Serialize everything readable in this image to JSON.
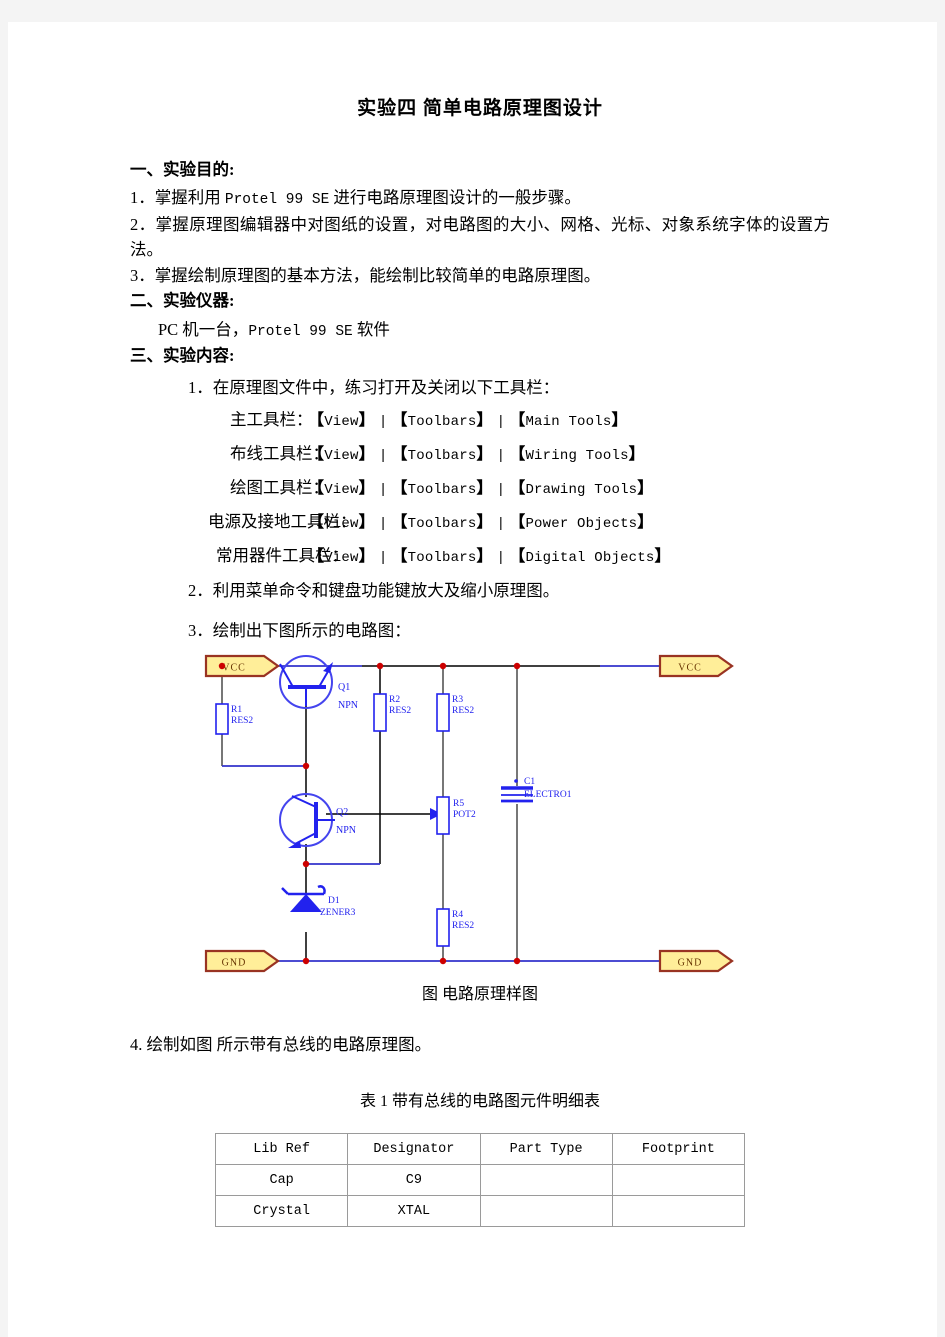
{
  "document": {
    "title": "实验四  简单电路原理图设计",
    "sections": [
      {
        "heading": "一、实验目的:"
      },
      {
        "heading": "二、实验仪器:"
      },
      {
        "heading": "三、实验内容:"
      }
    ],
    "purpose_items": [
      "1．掌握利用 Protel 99   SE 进行电路原理图设计的一般步骤。",
      "2．掌握原理图编辑器中对图纸的设置，对电路图的大小、网格、光标、对象系统字体的设置方法。",
      "3．掌握绘制原理图的基本方法，能绘制比较简单的电路原理图。"
    ],
    "purpose_1_pre": "1．掌握利用 ",
    "purpose_1_mono": "Protel 99   SE",
    "purpose_1_post": " 进行电路原理图设计的一般步骤。",
    "purpose_2": "2．掌握原理图编辑器中对图纸的设置，对电路图的大小、网格、光标、对象系统字体的设置方法。",
    "purpose_3": "3．掌握绘制原理图的基本方法，能绘制比较简单的电路原理图。",
    "instrument_pre": "PC 机一台，",
    "instrument_mono": "Protel 99 SE",
    "instrument_post": " 软件",
    "content_item_1": "1．在原理图文件中，练习打开及关闭以下工具栏：",
    "content_item_2": "2．利用菜单命令和键盘功能键放大及缩小原理图。",
    "content_item_3": "3．绘制出下图所示的电路图：",
    "content_item_4": "4.  绘制如图  所示带有总线的电路原理图。",
    "figure_caption": "图  电路原理样图",
    "table_caption": "表 1  带有总线的电路图元件明细表"
  },
  "toolbars": [
    {
      "label": "主工具栏：",
      "menu": "View",
      "sub": "Toolbars",
      "item": "Main Tools"
    },
    {
      "label": "布线工具栏：",
      "menu": "View",
      "sub": "Toolbars",
      "item": "Wiring Tools"
    },
    {
      "label": "绘图工具栏：",
      "menu": "View",
      "sub": "Toolbars",
      "item": "Drawing Tools"
    },
    {
      "label": "电源及接地工具栏：",
      "menu": "View",
      "sub": "Toolbars",
      "item": "Power Objects"
    },
    {
      "label": "常用器件工具栏：",
      "menu": "View",
      "sub": "Toolbars",
      "item": "Digital Objects"
    }
  ],
  "circuit": {
    "colors": {
      "wire": "#000000",
      "wire_blue": "#3333cc",
      "component": "#2222ee",
      "junction": "#cc0000",
      "port_fill": "#ffee99",
      "port_border": "#993322",
      "port_text": "#663300",
      "gray_wire": "#777777"
    },
    "ports": [
      {
        "name": "VCC",
        "position": "top-left"
      },
      {
        "name": "VCC",
        "position": "top-right"
      },
      {
        "name": "GND",
        "position": "bottom-left"
      },
      {
        "name": "GND",
        "position": "bottom-right"
      }
    ],
    "components": [
      {
        "designator": "R1",
        "part": "RES2",
        "type": "resistor"
      },
      {
        "designator": "R2",
        "part": "RES2",
        "type": "resistor"
      },
      {
        "designator": "R3",
        "part": "RES2",
        "type": "resistor"
      },
      {
        "designator": "R4",
        "part": "RES2",
        "type": "resistor"
      },
      {
        "designator": "R5",
        "part": "POT2",
        "type": "potentiometer"
      },
      {
        "designator": "Q1",
        "part": "NPN",
        "type": "transistor"
      },
      {
        "designator": "Q2",
        "part": "NPN",
        "type": "transistor"
      },
      {
        "designator": "D1",
        "part": "ZENER3",
        "type": "zener-diode"
      },
      {
        "designator": "C1",
        "part": "ELECTRO1",
        "type": "electrolytic-capacitor"
      }
    ]
  },
  "parts_table": {
    "headers": [
      "Lib Ref",
      "Designator",
      "Part Type",
      "Footprint"
    ],
    "rows": [
      [
        "Cap",
        "C9",
        "",
        ""
      ],
      [
        "Crystal",
        "XTAL",
        "",
        ""
      ]
    ]
  }
}
